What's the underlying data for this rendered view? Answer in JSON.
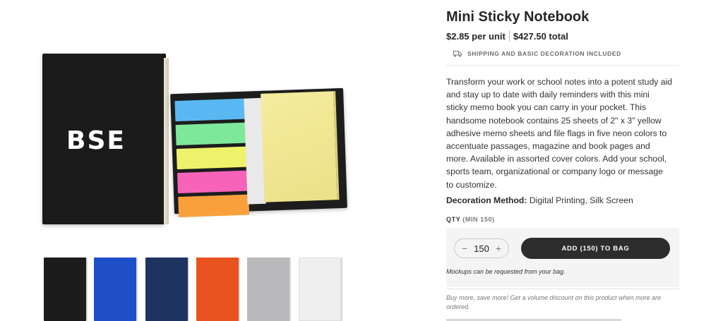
{
  "product": {
    "title": "Mini Sticky Notebook",
    "unit_price": "$2.85 per unit",
    "total_price": "$427.50 total",
    "shipping_note": "SHIPPING AND BASIC DECORATION INCLUDED",
    "description": "Transform your work or school notes into a potent study aid and stay up to date with daily reminders with this mini sticky memo book you can carry in your pocket. This handsome notebook contains 25 sheets of 2\" x 3\" yellow adhesive memo sheets and file flags in five neon colors to accentuate passages, magazine and book pages and more. Available in assorted cover colors. Add your school, sports team, organizational or company logo or message to customize.",
    "decoration_label": "Decoration Method:",
    "decoration_value": "Digital Printing, Silk Screen",
    "logo_text": "BSE"
  },
  "order": {
    "qty_label": "QTY",
    "qty_min": "(MIN 150)",
    "quantity": "150",
    "minus_symbol": "−",
    "plus_symbol": "+",
    "add_button_label": "ADD (150) TO BAG",
    "mockups_note": "Mockups can be requested from your bag.",
    "volume_note": "Buy more, save more! Get a volume discount on this product when more are ordered."
  },
  "colors": {
    "flag_colors": [
      "#59b8f2",
      "#7ee89a",
      "#eef26a",
      "#f763b9",
      "#f9a03c"
    ],
    "thumbnail_colors": [
      "#1c1c1c",
      "#1f4ec9",
      "#1f3360",
      "#e8521e",
      "#b9b9bb",
      "#efefef"
    ],
    "button_bg": "#2d2d2d"
  }
}
